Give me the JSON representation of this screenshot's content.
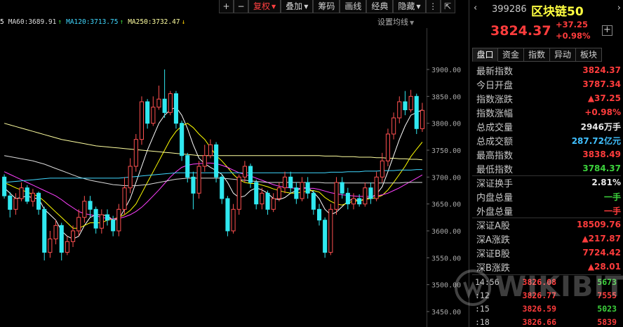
{
  "toolbar": {
    "plus": "+",
    "minus": "−",
    "items": [
      "复权",
      "叠加",
      "筹码",
      "画线",
      "经典",
      "隐藏"
    ],
    "more": "⋮",
    "arrows": "⇱",
    "active_index": 0
  },
  "ma_row": [
    {
      "label": "5",
      "color": "#ffffff",
      "arrow": ""
    },
    {
      "label": "MA60:3689.91",
      "color": "#dcdcdc",
      "arrow": "↑"
    },
    {
      "label": "MA120:3713.75",
      "color": "#40d8ff",
      "arrow": "↑"
    },
    {
      "label": "MA250:3732.47",
      "color": "#ffffa0",
      "arrow": "↓"
    }
  ],
  "ma_settings": "设置均线",
  "y_axis": [
    "3900.00",
    "3850.00",
    "3800.00",
    "3750.00",
    "3700.00",
    "3650.00",
    "3600.00",
    "3550.00",
    "3500.00",
    "3450.00"
  ],
  "header": {
    "nav_left": "‹",
    "nav_right": "›",
    "code": "399286",
    "name": "区块链50",
    "price": "3824.37",
    "change": "+37.25",
    "change_pct": "+0.98%",
    "plus": "+"
  },
  "tabs": [
    "盘口",
    "资金",
    "指数",
    "异动",
    "板块"
  ],
  "stats_a": [
    {
      "label": "最新指数",
      "value": "3824.37",
      "color": "red"
    },
    {
      "label": "今日开盘",
      "value": "3787.34",
      "color": "red"
    },
    {
      "label": "指数涨跌",
      "value": "▲37.25",
      "color": "red"
    },
    {
      "label": "指数涨幅",
      "value": "+0.98%",
      "color": "red"
    },
    {
      "label": "总成交量",
      "value": "2946万手",
      "color": "white"
    },
    {
      "label": "总成交额",
      "value": "287.72亿元",
      "color": "cyan"
    },
    {
      "label": "最高指数",
      "value": "3838.49",
      "color": "red"
    },
    {
      "label": "最低指数",
      "value": "3784.37",
      "color": "green"
    }
  ],
  "stats_b": [
    {
      "label": "深证换手",
      "value": "2.81%",
      "color": "white"
    },
    {
      "label": "内盘总量",
      "value": "一手",
      "color": "green"
    },
    {
      "label": "外盘总量",
      "value": "一手",
      "color": "red"
    }
  ],
  "stats_c": [
    {
      "label": "深证A股",
      "value": "18509.76",
      "color": "red"
    },
    {
      "label": "深A涨跌",
      "value": "▲217.87",
      "color": "red"
    },
    {
      "label": "深证B股",
      "value": "7724.42",
      "color": "red"
    },
    {
      "label": "深B涨跌",
      "value": "▲28.01",
      "color": "red"
    }
  ],
  "ticks": [
    {
      "time": "14:56",
      "price": "3826.08",
      "vol": "5673",
      "color": "green"
    },
    {
      "time": ":12",
      "price": "3826.77",
      "vol": "7555",
      "color": "red"
    },
    {
      "time": ":15",
      "price": "3826.59",
      "vol": "5023",
      "color": "green"
    },
    {
      "time": ":18",
      "price": "3826.66",
      "vol": "5839",
      "color": "red"
    }
  ],
  "watermark": "WIKIBIT",
  "chart_data": {
    "type": "candlestick",
    "ylim": [
      3450,
      3900
    ],
    "up_color": "#ff5050",
    "down_color": "#30e8f0",
    "candles": [
      [
        3700,
        3665,
        3705,
        3660
      ],
      [
        3665,
        3640,
        3672,
        3625
      ],
      [
        3640,
        3660,
        3670,
        3630
      ],
      [
        3660,
        3680,
        3690,
        3655
      ],
      [
        3680,
        3655,
        3685,
        3650
      ],
      [
        3655,
        3670,
        3678,
        3645
      ],
      [
        3670,
        3640,
        3673,
        3630
      ],
      [
        3640,
        3560,
        3645,
        3545
      ],
      [
        3560,
        3585,
        3600,
        3550
      ],
      [
        3585,
        3610,
        3620,
        3575
      ],
      [
        3610,
        3560,
        3615,
        3545
      ],
      [
        3560,
        3580,
        3590,
        3555
      ],
      [
        3580,
        3600,
        3610,
        3570
      ],
      [
        3600,
        3625,
        3640,
        3590
      ],
      [
        3625,
        3655,
        3665,
        3615
      ],
      [
        3655,
        3640,
        3665,
        3625
      ],
      [
        3640,
        3605,
        3645,
        3595
      ],
      [
        3605,
        3630,
        3640,
        3595
      ],
      [
        3630,
        3620,
        3640,
        3610
      ],
      [
        3620,
        3600,
        3628,
        3590
      ],
      [
        3600,
        3640,
        3650,
        3590
      ],
      [
        3640,
        3680,
        3700,
        3630
      ],
      [
        3680,
        3720,
        3735,
        3670
      ],
      [
        3720,
        3770,
        3780,
        3710
      ],
      [
        3770,
        3840,
        3850,
        3760
      ],
      [
        3840,
        3800,
        3845,
        3790
      ],
      [
        3800,
        3830,
        3850,
        3795
      ],
      [
        3830,
        3845,
        3870,
        3825
      ],
      [
        3845,
        3820,
        3900,
        3810
      ],
      [
        3820,
        3855,
        3860,
        3815
      ],
      [
        3855,
        3800,
        3860,
        3790
      ],
      [
        3800,
        3740,
        3805,
        3730
      ],
      [
        3740,
        3700,
        3745,
        3690
      ],
      [
        3700,
        3670,
        3710,
        3640
      ],
      [
        3670,
        3720,
        3730,
        3660
      ],
      [
        3720,
        3740,
        3760,
        3710
      ],
      [
        3740,
        3760,
        3770,
        3735
      ],
      [
        3760,
        3700,
        3765,
        3690
      ],
      [
        3700,
        3660,
        3705,
        3650
      ],
      [
        3660,
        3600,
        3665,
        3590
      ],
      [
        3600,
        3640,
        3650,
        3595
      ],
      [
        3640,
        3700,
        3705,
        3630
      ],
      [
        3700,
        3720,
        3730,
        3690
      ],
      [
        3720,
        3690,
        3725,
        3680
      ],
      [
        3690,
        3650,
        3695,
        3640
      ],
      [
        3650,
        3670,
        3680,
        3640
      ],
      [
        3670,
        3640,
        3675,
        3630
      ],
      [
        3640,
        3660,
        3670,
        3635
      ],
      [
        3660,
        3680,
        3690,
        3655
      ],
      [
        3680,
        3700,
        3710,
        3670
      ],
      [
        3700,
        3680,
        3710,
        3670
      ],
      [
        3680,
        3660,
        3690,
        3650
      ],
      [
        3660,
        3690,
        3700,
        3655
      ],
      [
        3690,
        3670,
        3700,
        3660
      ],
      [
        3670,
        3640,
        3675,
        3630
      ],
      [
        3640,
        3620,
        3650,
        3610
      ],
      [
        3620,
        3560,
        3625,
        3550
      ],
      [
        3560,
        3640,
        3650,
        3555
      ],
      [
        3640,
        3690,
        3700,
        3630
      ],
      [
        3690,
        3670,
        3700,
        3660
      ],
      [
        3670,
        3650,
        3680,
        3640
      ],
      [
        3650,
        3660,
        3670,
        3640
      ],
      [
        3660,
        3650,
        3668,
        3645
      ],
      [
        3650,
        3680,
        3690,
        3645
      ],
      [
        3680,
        3660,
        3690,
        3650
      ],
      [
        3660,
        3700,
        3710,
        3655
      ],
      [
        3700,
        3730,
        3745,
        3690
      ],
      [
        3730,
        3780,
        3790,
        3720
      ],
      [
        3780,
        3810,
        3820,
        3770
      ],
      [
        3810,
        3840,
        3850,
        3800
      ],
      [
        3840,
        3825,
        3860,
        3815
      ],
      [
        3825,
        3850,
        3862,
        3820
      ],
      [
        3850,
        3790,
        3855,
        3780
      ],
      [
        3790,
        3824,
        3838,
        3784
      ]
    ],
    "ma_lines": [
      {
        "name": "MA5",
        "color": "#ffffff",
        "values": [
          3680,
          3670,
          3660,
          3662,
          3665,
          3661,
          3660,
          3640,
          3630,
          3620,
          3600,
          3590,
          3585,
          3590,
          3610,
          3625,
          3630,
          3630,
          3628,
          3620,
          3622,
          3640,
          3660,
          3690,
          3720,
          3750,
          3775,
          3800,
          3815,
          3825,
          3830,
          3815,
          3790,
          3760,
          3735,
          3725,
          3718,
          3712,
          3705,
          3690,
          3670,
          3662,
          3665,
          3675,
          3680,
          3676,
          3670,
          3660,
          3658,
          3662,
          3670,
          3675,
          3680,
          3680,
          3672,
          3660,
          3640,
          3630,
          3635,
          3645,
          3655,
          3660,
          3655,
          3660,
          3662,
          3668,
          3682,
          3710,
          3740,
          3770,
          3795,
          3815,
          3820,
          3825
        ]
      },
      {
        "name": "MA10",
        "color": "#ffff00",
        "values": [
          3690,
          3685,
          3680,
          3676,
          3672,
          3668,
          3664,
          3655,
          3645,
          3635,
          3625,
          3615,
          3605,
          3605,
          3610,
          3615,
          3615,
          3615,
          3620,
          3622,
          3625,
          3630,
          3638,
          3650,
          3670,
          3690,
          3710,
          3730,
          3750,
          3770,
          3785,
          3795,
          3800,
          3792,
          3780,
          3770,
          3755,
          3740,
          3730,
          3718,
          3705,
          3695,
          3690,
          3688,
          3688,
          3685,
          3682,
          3678,
          3675,
          3672,
          3670,
          3670,
          3672,
          3674,
          3675,
          3672,
          3662,
          3655,
          3650,
          3648,
          3652,
          3655,
          3656,
          3658,
          3660,
          3662,
          3666,
          3676,
          3690,
          3705,
          3720,
          3738,
          3752,
          3765
        ]
      },
      {
        "name": "MA20",
        "color": "#ff40ff",
        "values": [
          3710,
          3705,
          3700,
          3695,
          3690,
          3685,
          3680,
          3675,
          3670,
          3665,
          3658,
          3650,
          3643,
          3636,
          3632,
          3630,
          3628,
          3625,
          3623,
          3622,
          3623,
          3626,
          3630,
          3636,
          3644,
          3654,
          3665,
          3676,
          3688,
          3700,
          3710,
          3718,
          3722,
          3724,
          3725,
          3726,
          3726,
          3725,
          3722,
          3718,
          3713,
          3708,
          3705,
          3702,
          3698,
          3694,
          3690,
          3686,
          3683,
          3681,
          3680,
          3679,
          3679,
          3679,
          3679,
          3677,
          3674,
          3671,
          3669,
          3667,
          3666,
          3665,
          3664,
          3664,
          3664,
          3665,
          3667,
          3670,
          3675,
          3680,
          3686,
          3692,
          3698,
          3704
        ]
      },
      {
        "name": "MA60",
        "color": "#dcdcdc",
        "values": [
          3740,
          3738,
          3736,
          3734,
          3732,
          3730,
          3727,
          3724,
          3720,
          3716,
          3712,
          3708,
          3704,
          3700,
          3697,
          3694,
          3692,
          3690,
          3688,
          3686,
          3685,
          3684,
          3684,
          3684,
          3685,
          3686,
          3688,
          3690,
          3692,
          3694,
          3696,
          3697,
          3698,
          3698,
          3698,
          3698,
          3698,
          3698,
          3698,
          3697,
          3696,
          3695,
          3694,
          3693,
          3692,
          3691,
          3690,
          3690,
          3690,
          3690,
          3690,
          3690,
          3690,
          3690,
          3690,
          3690,
          3689,
          3689,
          3689,
          3689,
          3689,
          3689,
          3689,
          3689,
          3689,
          3689,
          3689,
          3689,
          3689,
          3689,
          3690,
          3690,
          3690,
          3690
        ]
      },
      {
        "name": "MA120",
        "color": "#40d8ff",
        "values": [
          3690,
          3691,
          3692,
          3693,
          3694,
          3695,
          3696,
          3697,
          3698,
          3698,
          3698,
          3698,
          3698,
          3698,
          3698,
          3698,
          3698,
          3698,
          3698,
          3698,
          3698,
          3699,
          3700,
          3701,
          3702,
          3703,
          3704,
          3705,
          3706,
          3707,
          3708,
          3708,
          3708,
          3708,
          3708,
          3708,
          3708,
          3708,
          3708,
          3708,
          3708,
          3708,
          3708,
          3708,
          3708,
          3708,
          3708,
          3708,
          3708,
          3708,
          3708,
          3708,
          3708,
          3708,
          3708,
          3708,
          3708,
          3709,
          3709,
          3709,
          3710,
          3710,
          3710,
          3711,
          3711,
          3711,
          3712,
          3712,
          3712,
          3713,
          3713,
          3713,
          3714,
          3714
        ]
      },
      {
        "name": "MA250",
        "color": "#ffffa0",
        "values": [
          3800,
          3797,
          3794,
          3791,
          3788,
          3785,
          3782,
          3779,
          3776,
          3773,
          3770,
          3768,
          3766,
          3764,
          3762,
          3760,
          3758,
          3757,
          3756,
          3755,
          3754,
          3753,
          3752,
          3751,
          3750,
          3749,
          3748,
          3747,
          3746,
          3745,
          3744,
          3743,
          3742,
          3741,
          3740,
          3740,
          3740,
          3740,
          3740,
          3740,
          3740,
          3740,
          3740,
          3740,
          3740,
          3740,
          3740,
          3740,
          3740,
          3740,
          3740,
          3740,
          3740,
          3740,
          3740,
          3740,
          3739,
          3739,
          3739,
          3738,
          3738,
          3738,
          3737,
          3737,
          3737,
          3736,
          3736,
          3735,
          3735,
          3734,
          3734,
          3733,
          3733,
          3732
        ]
      }
    ]
  }
}
